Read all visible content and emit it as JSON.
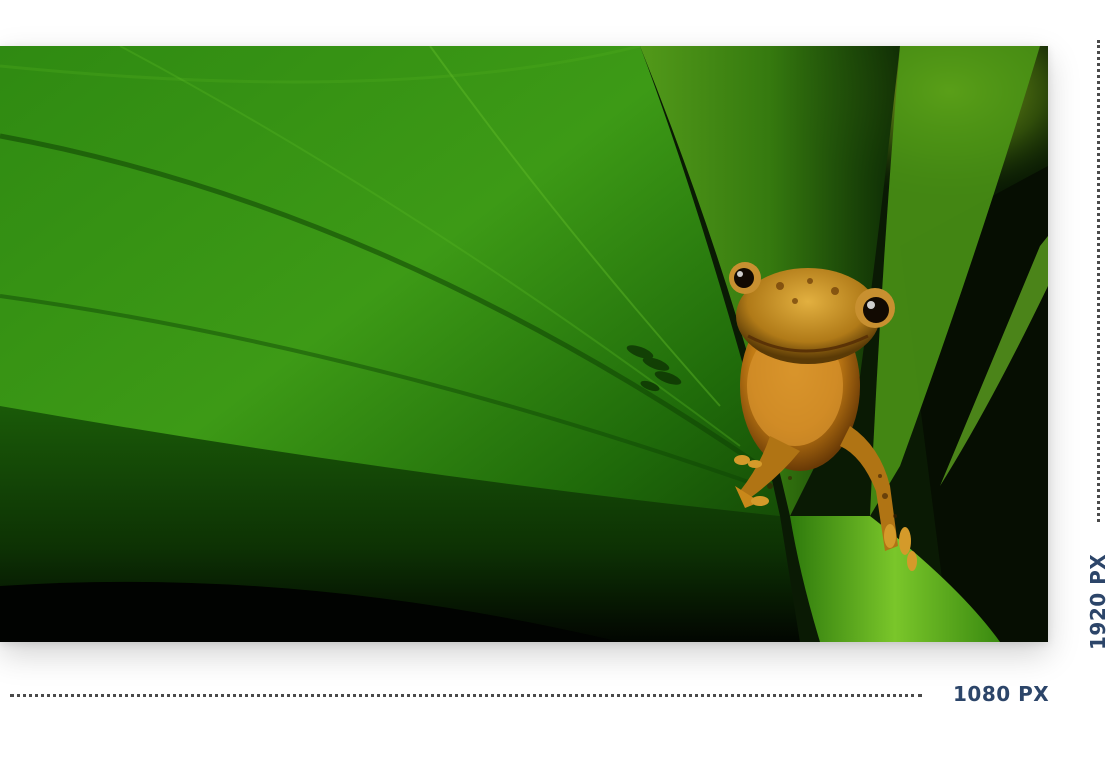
{
  "image": {
    "subject": "frog-on-leaf",
    "colors": {
      "leaf_dark": "#0f3a06",
      "leaf_mid": "#2f8a12",
      "leaf_light": "#6fbf2a",
      "background_dark": "#0a1a04",
      "frog_body": "#c98a18",
      "frog_belly": "#e0a030"
    }
  },
  "dimensions": {
    "height_label": "1920 PX",
    "width_label": "1080 PX",
    "label_color": "#2c4569"
  }
}
